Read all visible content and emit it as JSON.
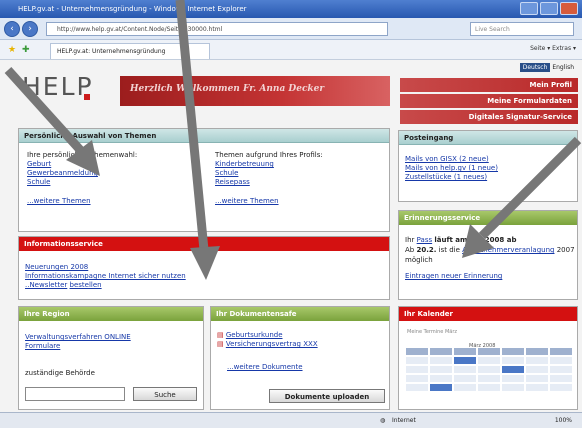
{
  "browser": {
    "title": "HELP.gv.at - Unternehmensgründung - Windows Internet Explorer",
    "url": "http://www.help.gv.at/Content.Node/Seite.230000.html",
    "search_placeholder": "Live Search",
    "tab_title": "HELP.gv.at: Unternehmensgründung",
    "tools": "Seite ▾  Extras ▾",
    "status_zoom": "100%",
    "status_zone": "Internet"
  },
  "header": {
    "lang_active": "Deutsch",
    "lang_other": "English",
    "logo": "HELP",
    "welcome": "Herzlich Willkommen Fr. Anna Decker",
    "red_links": [
      "Mein Profil",
      "Meine Formulardaten",
      "Digitales Signatur-Service"
    ]
  },
  "auswahl": {
    "title": "Persönliche Auswahl von Themen",
    "left_heading": "Ihre persönlichen Themenwahl:",
    "left_links": [
      "Geburt",
      "Gewerbeanmeldung",
      "Schule"
    ],
    "left_more": "...weitere Themen",
    "right_heading": "Themen aufgrund Ihres Profils:",
    "right_links": [
      "Kinderbetreuung",
      "Schule",
      "Reisepass"
    ],
    "right_more": "...weitere Themen"
  },
  "info": {
    "title": "Informationsservice",
    "links": [
      "Neuerungen 2008",
      "Informationskampagne Internet sicher nutzen"
    ],
    "newsletter_prefix": "..Newsletter",
    "newsletter_link": "bestellen"
  },
  "region": {
    "title": "Ihre Region",
    "link1": "Verwaltungsverfahren ONLINE",
    "link2": "Formulare",
    "label": "zuständige Behörde",
    "search_button": "Suche"
  },
  "dokumente": {
    "title": "Ihr Dokumentensafe",
    "items": [
      "Geburtsurkunde",
      "Versicherungsvertrag XXX"
    ],
    "more": "...weitere Dokumente",
    "upload_button": "Dokumente uploaden"
  },
  "posteingang": {
    "title": "Posteingang",
    "links": [
      "Mails von GISX (2 neue)",
      "Mails von help.gv (1 neue)",
      "Zustellstücke (1 neues)"
    ]
  },
  "erinnerung": {
    "title": "Erinnerungsservice",
    "line1_prefix": "Ihr",
    "line1_link": "Pass",
    "line1_suffix": "läuft am 1.7.2008 ab",
    "line2_prefix": "Ab",
    "line2_bold": "20.2.",
    "line2_mid": "ist die",
    "line2_link": "Arbeitnehmerveranlagung",
    "line2_suffix": "2007 möglich",
    "new_link": "Eintragen neuer Erinnerung"
  },
  "kalender": {
    "title": "Ihr Kalender",
    "caption": "Meine Termine März",
    "month": "März 2008"
  },
  "colors": {
    "red": "#d41111",
    "teal": "#a9cfcf",
    "green": "#7aa23c",
    "link": "#1638a8"
  }
}
